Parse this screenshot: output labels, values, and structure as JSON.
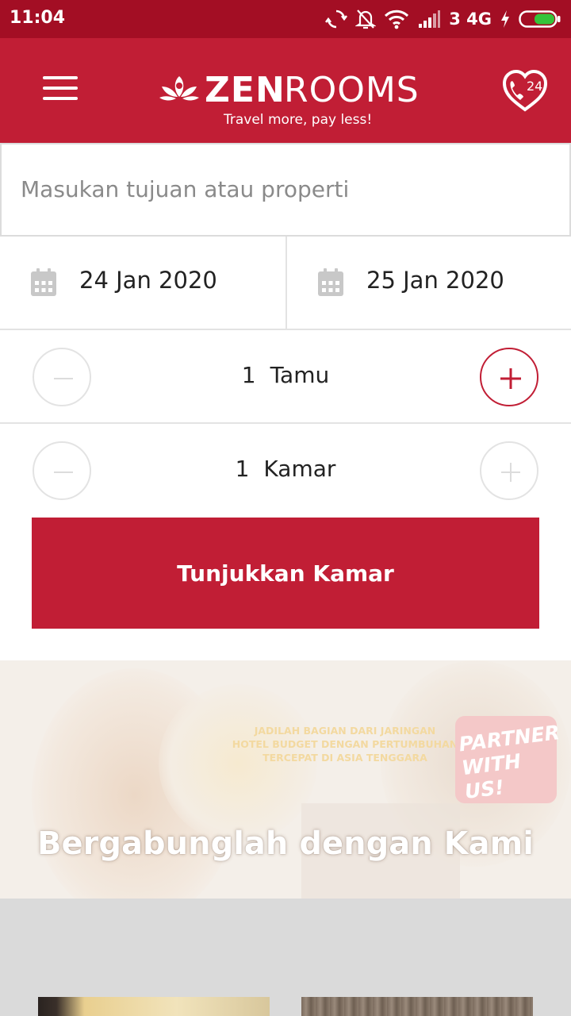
{
  "status_bar": {
    "time": "11:04",
    "network": "3 4G",
    "icons": [
      "sync-icon",
      "notifications-off-icon",
      "wifi-icon",
      "signal-icon",
      "charging-icon",
      "battery-icon"
    ]
  },
  "header": {
    "logo_zen": "ZEN",
    "logo_rooms": "ROOMS",
    "tagline": "Travel more, pay less!",
    "support_badge": "24",
    "colors": {
      "primary": "#c11e35",
      "status_bar": "#a30e24"
    }
  },
  "search": {
    "placeholder": "Masukan tujuan atau properti"
  },
  "dates": {
    "check_in": "24 Jan 2020",
    "check_out": "25 Jan 2020"
  },
  "guests": {
    "count": "1",
    "label": "Tamu"
  },
  "rooms": {
    "count": "1",
    "label": "Kamar"
  },
  "cta": {
    "label": "Tunjukkan Kamar"
  },
  "banner": {
    "note_line1": "JADILAH BAGIAN DARI JARINGAN",
    "note_line2": "HOTEL BUDGET DENGAN PERTUMBUHAN",
    "note_line3": "TERCEPAT DI ASIA TENGGARA",
    "badge_line1": "PARTNER",
    "badge_line2": "WITH US!",
    "title": "Bergabunglah dengan Kami"
  }
}
